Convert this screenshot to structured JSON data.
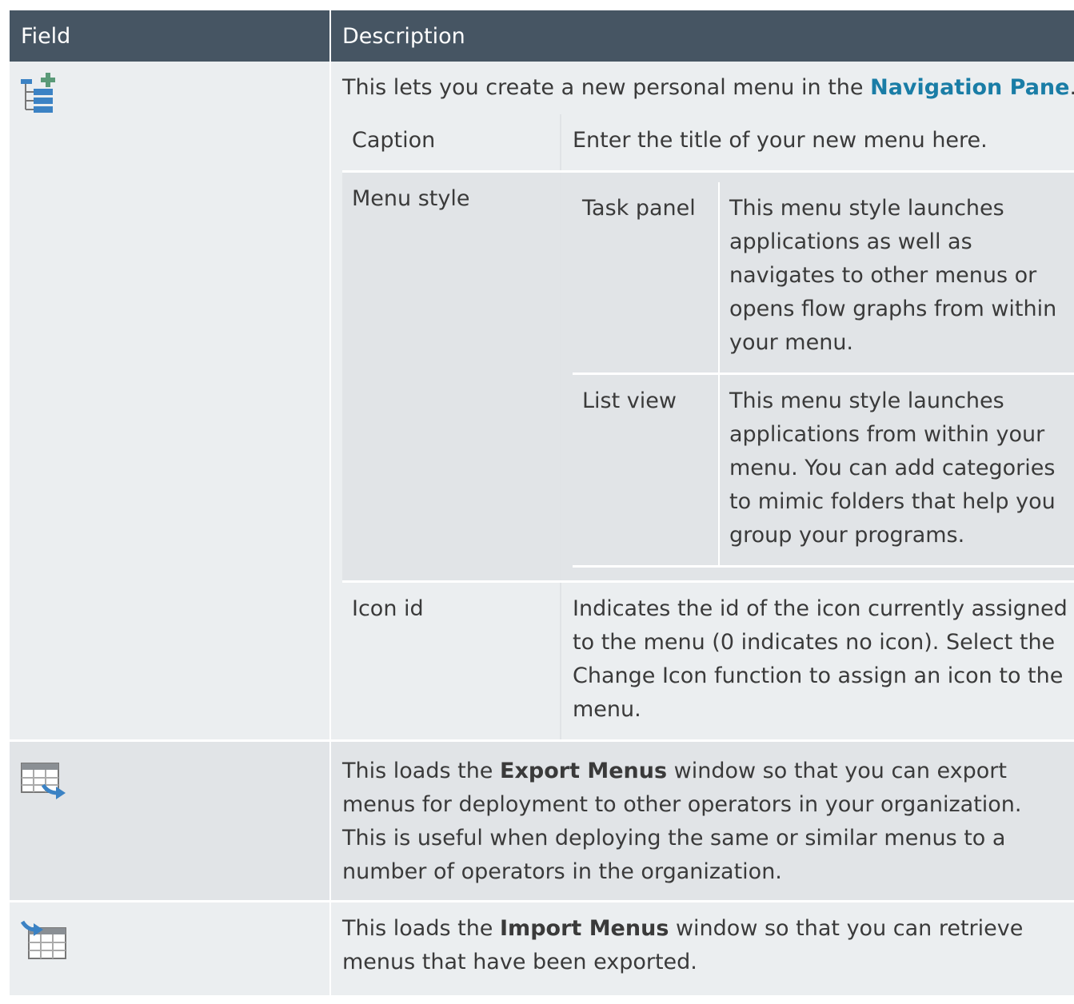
{
  "header": {
    "field": "Field",
    "description": "Description"
  },
  "rows": {
    "new_menu": {
      "icon": "new-menu-icon",
      "intro_before": "This lets you create a new personal menu in the ",
      "intro_link": "Navigation Pane",
      "intro_after": ".",
      "sub": {
        "caption": {
          "label": "Caption",
          "desc": "Enter the title of your new menu here."
        },
        "menu_style": {
          "label": "Menu style",
          "task_panel": {
            "label": "Task panel",
            "desc": "This menu style launches applications as well as navigates to other menus or opens flow graphs from within your menu."
          },
          "list_view": {
            "label": "List view",
            "desc": "This menu style launches applications from within your menu. You can add categories to mimic folders that help you group your programs."
          }
        },
        "icon_id": {
          "label": "Icon id",
          "desc": "Indicates the id of the icon currently assigned to the menu (0 indicates no icon). Select the Change Icon function to assign an icon to the menu."
        }
      }
    },
    "export": {
      "icon": "export-menus-icon",
      "before": "This loads the ",
      "bold": "Export Menus",
      "after": " window so that you can export menus for deployment to other operators in your organization. This is useful when deploying the same or similar menus to a number of operators in the organization."
    },
    "import": {
      "icon": "import-menus-icon",
      "before": "This loads the ",
      "bold": "Import Menus",
      "after": " window so that you can retrieve menus that have been exported."
    }
  },
  "colors": {
    "header_bg": "#465563",
    "link": "#1a7da6",
    "icon_blue": "#3b82c4",
    "icon_green": "#5a9a78"
  }
}
